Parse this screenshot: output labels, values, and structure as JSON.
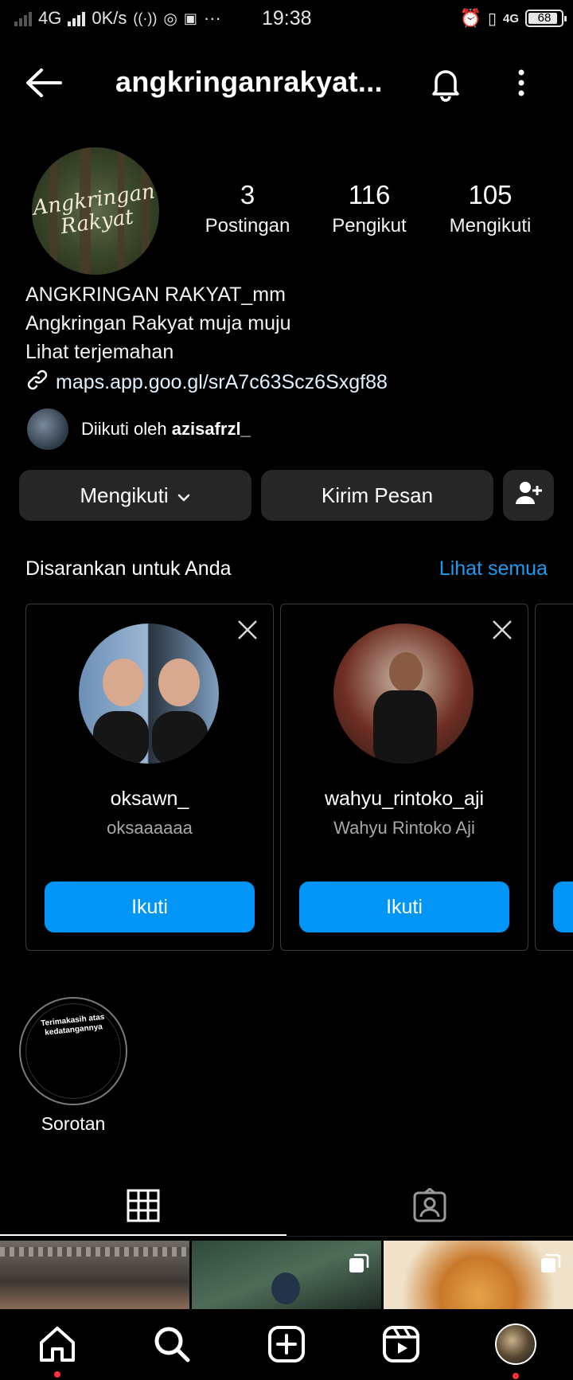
{
  "status_bar": {
    "network": "4G",
    "speed": "0K/s",
    "time": "19:38",
    "network_right": "4G",
    "battery": "68"
  },
  "header": {
    "username": "angkringanrakyat..."
  },
  "profile": {
    "avatar_text": "Angkringan Rakyat",
    "stats": [
      {
        "value": "3",
        "label": "Postingan"
      },
      {
        "value": "116",
        "label": "Pengikut"
      },
      {
        "value": "105",
        "label": "Mengikuti"
      }
    ],
    "name": "ANGKRINGAN RAKYAT_mm",
    "bio": "Angkringan Rakyat muja muju",
    "translate": "Lihat terjemahan",
    "link": "maps.app.goo.gl/srA7c63Scz6Sxgf88",
    "followed_by_prefix": "Diikuti oleh",
    "followed_by_user": "azisafrzl_"
  },
  "actions": {
    "following": "Mengikuti",
    "message": "Kirim Pesan"
  },
  "suggestions": {
    "title": "Disarankan untuk Anda",
    "see_all": "Lihat semua",
    "cards": [
      {
        "username": "oksawn_",
        "name": "oksaaaaaa",
        "button": "Ikuti"
      },
      {
        "username": "wahyu_rintoko_aji",
        "name": "Wahyu Rintoko Aji",
        "button": "Ikuti"
      }
    ]
  },
  "highlight": {
    "text": "Terimakasih atas kedatangannya",
    "label": "Sorotan"
  },
  "colors": {
    "accent": "#0095f6",
    "link": "#1d9bf0",
    "button_bg": "#262626",
    "notification_dot": "#ff3040"
  }
}
